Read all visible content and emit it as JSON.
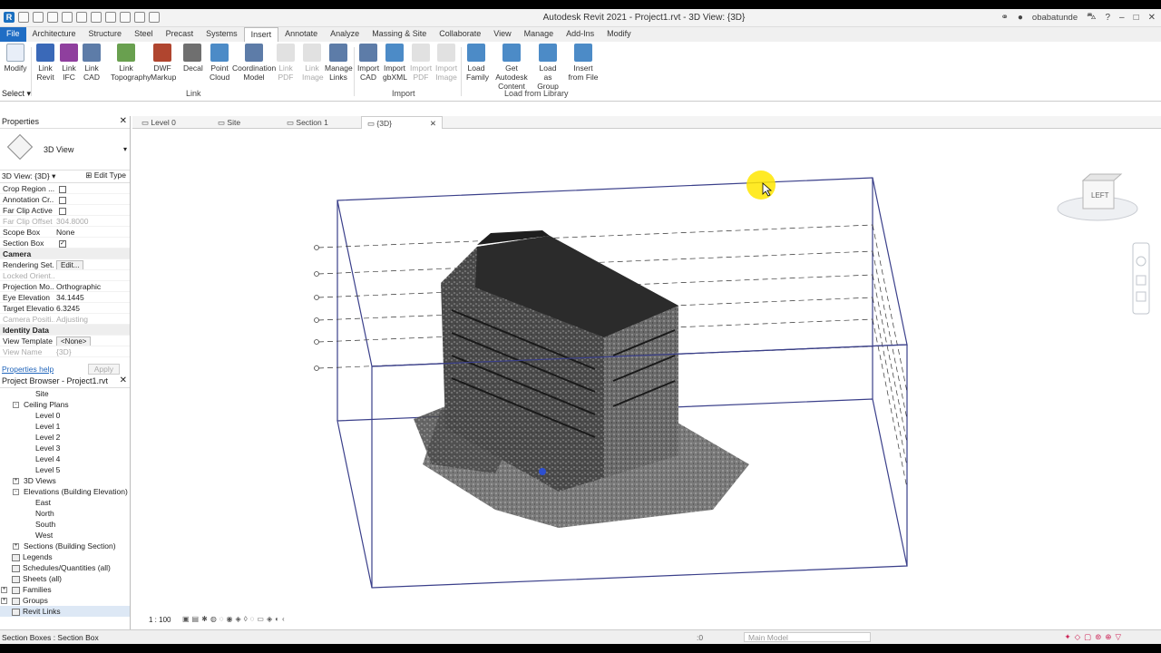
{
  "window": {
    "title": "Autodesk Revit 2021 - Project1.rvt - 3D View: {3D}",
    "user": "obabatunde"
  },
  "ribbon_tabs": [
    "File",
    "Architecture",
    "Structure",
    "Steel",
    "Precast",
    "Systems",
    "Insert",
    "Annotate",
    "Analyze",
    "Massing & Site",
    "Collaborate",
    "View",
    "Manage",
    "Add-Ins",
    "Modify"
  ],
  "ribbon": {
    "modify": "Modify",
    "select": "Select",
    "buttons": [
      {
        "l1": "Link",
        "l2": "Revit"
      },
      {
        "l1": "Link",
        "l2": "IFC"
      },
      {
        "l1": "Link",
        "l2": "CAD"
      },
      {
        "l1": "Link",
        "l2": "Topography"
      },
      {
        "l1": "DWF",
        "l2": "Markup"
      },
      {
        "l1": "Decal",
        "l2": ""
      },
      {
        "l1": "Point",
        "l2": "Cloud"
      },
      {
        "l1": "Coordination",
        "l2": "Model"
      },
      {
        "l1": "Link",
        "l2": "PDF"
      },
      {
        "l1": "Link",
        "l2": "Image"
      },
      {
        "l1": "Manage",
        "l2": "Links"
      },
      {
        "l1": "Import",
        "l2": "CAD"
      },
      {
        "l1": "Import",
        "l2": "gbXML"
      },
      {
        "l1": "Import",
        "l2": "PDF"
      },
      {
        "l1": "Import",
        "l2": "Image"
      },
      {
        "l1": "Load",
        "l2": "Family"
      },
      {
        "l1": "Get Autodesk",
        "l2": "Content"
      },
      {
        "l1": "Load as",
        "l2": "Group"
      },
      {
        "l1": "Insert",
        "l2": "from File"
      }
    ],
    "groups": {
      "link": "Link",
      "import": "Import",
      "library": "Load from Library"
    }
  },
  "properties": {
    "title": "Properties",
    "type_name": "3D View",
    "view_selector": "3D View: {3D}",
    "edit_type": "Edit Type",
    "rows": [
      {
        "k": "Crop Region ...",
        "v": "",
        "type": "check"
      },
      {
        "k": "Annotation Cr...",
        "v": "",
        "type": "check"
      },
      {
        "k": "Far Clip Active",
        "v": "",
        "type": "check"
      },
      {
        "k": "Far Clip Offset",
        "v": "304.8000",
        "type": "gray"
      },
      {
        "k": "Scope Box",
        "v": "None",
        "type": "text"
      },
      {
        "k": "Section Box",
        "v": "",
        "type": "checked"
      },
      {
        "k": "Camera",
        "v": "",
        "type": "group"
      },
      {
        "k": "Rendering Set...",
        "v": "Edit...",
        "type": "button"
      },
      {
        "k": "Locked Orient...",
        "v": "",
        "type": "gray"
      },
      {
        "k": "Projection Mo...",
        "v": "Orthographic",
        "type": "text"
      },
      {
        "k": "Eye Elevation",
        "v": "34.1445",
        "type": "text"
      },
      {
        "k": "Target Elevation",
        "v": "6.3245",
        "type": "text"
      },
      {
        "k": "Camera Positi...",
        "v": "Adjusting",
        "type": "gray"
      },
      {
        "k": "Identity Data",
        "v": "",
        "type": "group"
      },
      {
        "k": "View Template",
        "v": "<None>",
        "type": "button"
      },
      {
        "k": "View Name",
        "v": "{3D}",
        "type": "gray"
      }
    ],
    "help": "Properties help",
    "apply": "Apply"
  },
  "browser": {
    "title": "Project Browser - Project1.rvt",
    "nodes": [
      {
        "label": "Site",
        "indent": 3,
        "exp": ""
      },
      {
        "label": "Ceiling Plans",
        "indent": 2,
        "exp": "-"
      },
      {
        "label": "Level 0",
        "indent": 3,
        "exp": ""
      },
      {
        "label": "Level 1",
        "indent": 3,
        "exp": ""
      },
      {
        "label": "Level 2",
        "indent": 3,
        "exp": ""
      },
      {
        "label": "Level 3",
        "indent": 3,
        "exp": ""
      },
      {
        "label": "Level 4",
        "indent": 3,
        "exp": ""
      },
      {
        "label": "Level 5",
        "indent": 3,
        "exp": ""
      },
      {
        "label": "3D Views",
        "indent": 2,
        "exp": "+"
      },
      {
        "label": "Elevations (Building Elevation)",
        "indent": 2,
        "exp": "-"
      },
      {
        "label": "East",
        "indent": 3,
        "exp": ""
      },
      {
        "label": "North",
        "indent": 3,
        "exp": ""
      },
      {
        "label": "South",
        "indent": 3,
        "exp": ""
      },
      {
        "label": "West",
        "indent": 3,
        "exp": ""
      },
      {
        "label": "Sections (Building Section)",
        "indent": 2,
        "exp": "+"
      },
      {
        "label": "Legends",
        "indent": 1,
        "exp": "",
        "icon": true
      },
      {
        "label": "Schedules/Quantities (all)",
        "indent": 1,
        "exp": "",
        "icon": true
      },
      {
        "label": "Sheets (all)",
        "indent": 1,
        "exp": "",
        "icon": true
      },
      {
        "label": "Families",
        "indent": 1,
        "exp": "+",
        "icon": true
      },
      {
        "label": "Groups",
        "indent": 1,
        "exp": "+",
        "icon": true
      },
      {
        "label": "Revit Links",
        "indent": 1,
        "exp": "",
        "icon": true,
        "selected": true
      }
    ]
  },
  "view_tabs": [
    {
      "label": "Level 0",
      "active": false
    },
    {
      "label": "Site",
      "active": false
    },
    {
      "label": "Section 1",
      "active": false
    },
    {
      "label": "{3D}",
      "active": true
    }
  ],
  "viewcube": {
    "face": "LEFT"
  },
  "view_bar": {
    "scale": "1 : 100"
  },
  "status": {
    "message": "Section Boxes : Section Box",
    "zero": ":0",
    "model": "Main Model"
  },
  "colors": {
    "file_tab": "#1f6dc4",
    "box_line": "#3a3f8a",
    "highlight": "#ffe600"
  }
}
